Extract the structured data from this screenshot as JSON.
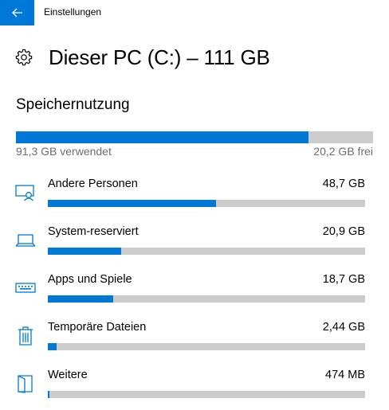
{
  "window": {
    "title": "Einstellungen"
  },
  "header": {
    "title": "Dieser PC (C:) – 111 GB",
    "icon": "gear-icon"
  },
  "storage": {
    "section_title": "Speichernutzung",
    "used_label": "91,3 GB verwendet",
    "free_label": "20,2 GB frei",
    "used_fraction": 0.819
  },
  "categories": [
    {
      "label": "Andere Personen",
      "size": "48,7 GB",
      "fraction": 0.53,
      "icon": "other-people-icon"
    },
    {
      "label": "System-reserviert",
      "size": "20,9 GB",
      "fraction": 0.23,
      "icon": "laptop-icon"
    },
    {
      "label": "Apps und Spiele",
      "size": "18,7 GB",
      "fraction": 0.205,
      "icon": "keyboard-icon"
    },
    {
      "label": "Temporäre Dateien",
      "size": "2,44 GB",
      "fraction": 0.028,
      "icon": "trash-icon"
    },
    {
      "label": "Weitere",
      "size": "474 MB",
      "fraction": 0.006,
      "icon": "folder-icon"
    }
  ],
  "colors": {
    "accent": "#0078d7",
    "track": "#cccccc",
    "secondary_text": "#6d6d6d"
  }
}
